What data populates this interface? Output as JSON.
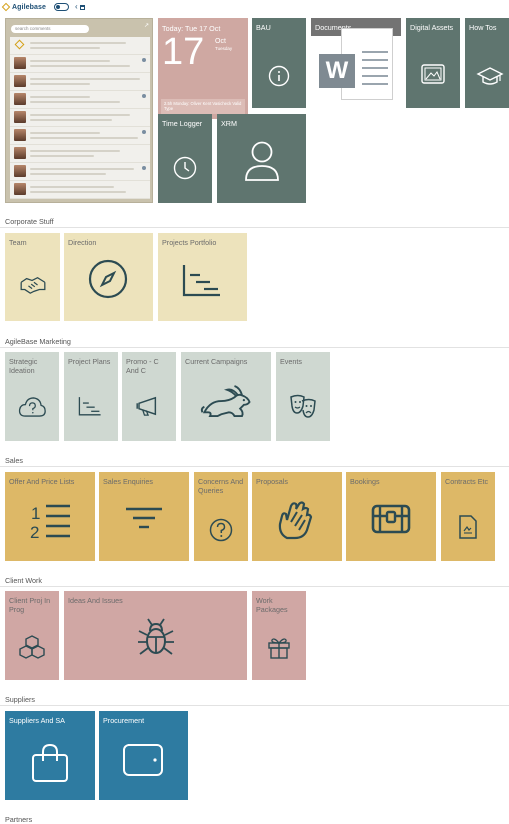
{
  "topbar": {
    "app_name": "Agilebase"
  },
  "comments": {
    "search_placeholder": "search comments",
    "count": 9
  },
  "calendar": {
    "today_label": "Today: Tue 17 Oct",
    "day_number": "17",
    "month": "Oct",
    "weekday": "Tuesday",
    "event_text": "2.5h Monday: Oliver Kent Vasicheck Valid Type",
    "color": "#cfa8a2"
  },
  "top_tiles": {
    "bau": "BAU",
    "documents": "Documents",
    "digital_assets": "Digital Assets",
    "how_tos": "How Tos",
    "time_logger": "Time Logger",
    "xrm": "XRM",
    "word_letter": "W"
  },
  "sections": [
    {
      "title": "Corporate Stuff",
      "tiles": [
        {
          "label": "Team",
          "icon": "handshake-icon"
        },
        {
          "label": "Direction",
          "icon": "compass-icon"
        },
        {
          "label": "Projects Portfolio",
          "icon": "gantt-icon"
        }
      ]
    },
    {
      "title": "AgileBase Marketing",
      "tiles": [
        {
          "label": "Strategic Ideation",
          "icon": "cloud-question-icon"
        },
        {
          "label": "Project Plans",
          "icon": "gantt-icon"
        },
        {
          "label": "Promo - C And C",
          "icon": "megaphone-icon"
        },
        {
          "label": "Current Campaigns",
          "icon": "rabbit-icon"
        },
        {
          "label": "Events",
          "icon": "theatre-masks-icon"
        }
      ]
    },
    {
      "title": "Sales",
      "tiles": [
        {
          "label": "Offer And Price Lists",
          "icon": "numbered-list-icon"
        },
        {
          "label": "Sales Enquiries",
          "icon": "filter-lines-icon"
        },
        {
          "label": "Concerns And Queries",
          "icon": "question-circle-icon"
        },
        {
          "label": "Proposals",
          "icon": "clapping-hands-icon"
        },
        {
          "label": "Bookings",
          "icon": "treasure-chest-icon"
        },
        {
          "label": "Contracts Etc",
          "icon": "document-icon"
        }
      ]
    },
    {
      "title": "Client Work",
      "tiles": [
        {
          "label": "Client Proj In Prog",
          "icon": "cubes-icon"
        },
        {
          "label": "Ideas And Issues",
          "icon": "bug-icon"
        },
        {
          "label": "Work Packages",
          "icon": "gift-icon"
        }
      ]
    },
    {
      "title": "Suppliers",
      "tiles": [
        {
          "label": "Suppliers And SA",
          "icon": "shopping-bag-icon"
        },
        {
          "label": "Procurement",
          "icon": "wallet-icon"
        }
      ]
    },
    {
      "title": "Partners",
      "tiles": []
    }
  ],
  "colors": {
    "slate": "#5f756f",
    "grey": "#737373",
    "cream": "#ede3bc",
    "sage": "#cfd8d1",
    "gold": "#ddb867",
    "rose": "#d0a7a4",
    "blue": "#2e7ba1",
    "icon_dark": "#2c4b52"
  }
}
